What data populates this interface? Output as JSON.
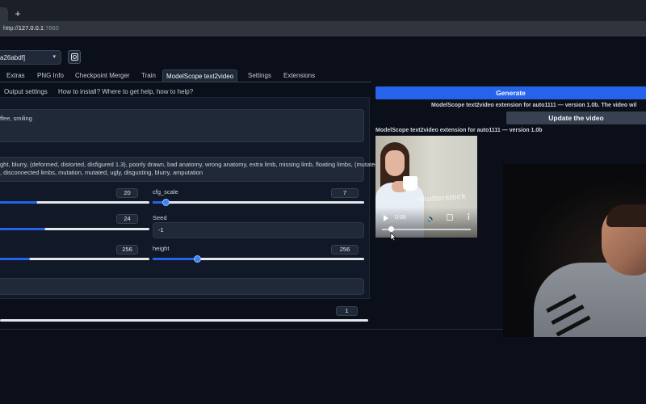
{
  "browser": {
    "new_tab_glyph": "+",
    "url_scheme": "http://",
    "url_host": "127.0.0.1",
    "url_port": ":7860"
  },
  "model": {
    "selected": "a26abdf]",
    "caret": "▾",
    "refresh_icon": "refresh-icon"
  },
  "main_tabs": [
    "Extras",
    "PNG Info",
    "Checkpoint Merger",
    "Train",
    "ModelScope text2video",
    "Settings",
    "Extensions"
  ],
  "active_main_tab": "ModelScope text2video",
  "sub_tabs": [
    "Output settings",
    "How to install? Where to get help, how to help?"
  ],
  "prompt": {
    "value": "ffee, smiling"
  },
  "negative_prompt": {
    "line1": "ght, blurry, (deformed, distorted, disfigured 1.3), poorly drawn, bad anatomy, wrong anatomy, extra limb, missing limb, floating limbs, (mutated",
    "line2": ", disconnected limbs, mutation, mutated, ugly, disgusting, blurry, amputation"
  },
  "sliders": {
    "steps": {
      "value": "20",
      "fraction": 0.25
    },
    "cfg_scale": {
      "label": "cfg_scale",
      "value": "7",
      "fraction": 0.06
    },
    "frames": {
      "value": "24",
      "fraction": 0.3
    },
    "seed": {
      "label": "Seed",
      "value": "-1"
    },
    "width": {
      "value": "256",
      "fraction": 0.2
    },
    "height": {
      "label": "height",
      "value": "256",
      "fraction": 0.21
    },
    "batch": {
      "value": "1",
      "fraction": 0.0
    }
  },
  "right": {
    "generate_label": "Generate",
    "status_text": "ModelScope text2video extension for auto1111 — version 1.0b. The video wil",
    "update_label": "Update the video",
    "video_title": "ModelScope text2video extension for auto1111 — version 1.0b"
  },
  "video": {
    "time": "0:00",
    "watermark": "shutterstock",
    "progress": 0.06,
    "volume_icon": "🔈",
    "more_icon": "⋮"
  },
  "colors": {
    "accent": "#2563eb",
    "background": "#0b0f19",
    "panel": "#111827"
  }
}
